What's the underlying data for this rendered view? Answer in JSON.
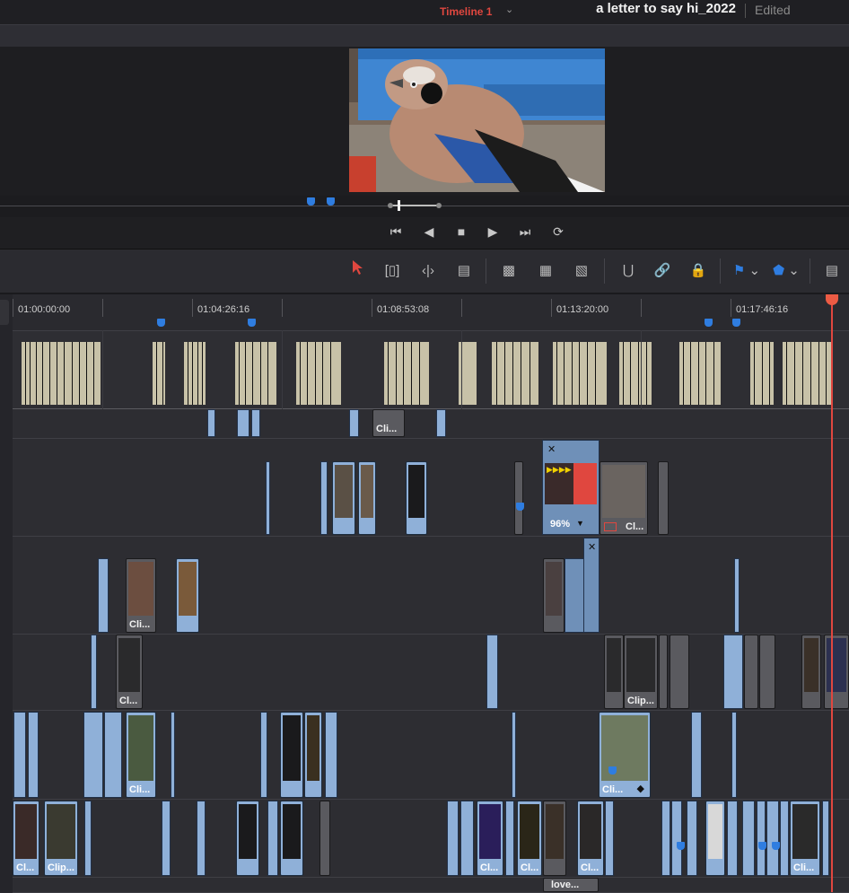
{
  "project": {
    "title": "a letter to say hi_2022",
    "status": "Edited"
  },
  "timeline": {
    "name": "Timeline 1",
    "chevron": "chevron-down"
  },
  "transport": {
    "icons": [
      "skip-to-start-icon",
      "step-back-icon",
      "stop-icon",
      "play-icon",
      "skip-to-end-icon",
      "loop-icon"
    ]
  },
  "toolbar": {
    "icons": [
      "select-arrow-icon",
      "trim-icon",
      "dynamic-trim-icon",
      "blade-icon",
      "insert-icon",
      "overwrite-icon",
      "replace-icon",
      "snapping-icon",
      "link-icon",
      "lock-icon",
      "flag-icon",
      "marker-icon",
      "view-options-icon"
    ]
  },
  "ruler": {
    "timecodes": [
      "01:00:00:00",
      "01:04:26:16",
      "01:08:53:08",
      "01:13:20:00",
      "01:17:46:16"
    ]
  },
  "clips": {
    "v6_a": "Cli...",
    "v5_speed": "96%",
    "v5_b": "Cl...",
    "v4_a": "Cli...",
    "v3_a": "Cl...",
    "v3_b": "Clip...",
    "v2_a": "Cli...",
    "v2_b": "Cli...",
    "v1_a": "Cl...",
    "v1_b": "Clip...",
    "v1_c": "Cl...",
    "v1_d": "Cl...",
    "v1_e": "Cl...",
    "v1_f": "Cli...",
    "v0_a": "love..."
  },
  "colors": {
    "accent": "#e0473f",
    "clip": "#8fb0d8",
    "marker": "#2f7de0",
    "audio": "#c8c2a8"
  }
}
